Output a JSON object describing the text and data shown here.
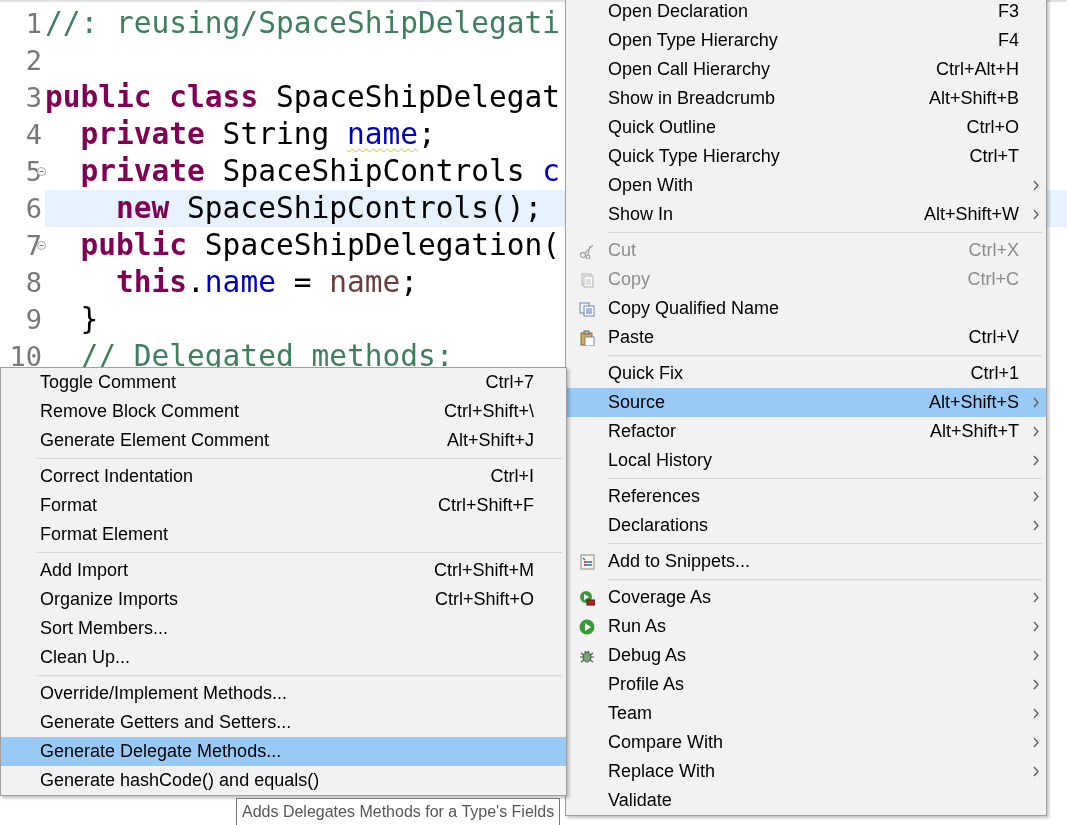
{
  "editor": {
    "lines": [
      {
        "number": "1",
        "fold": false,
        "current": false,
        "tokens": [
          {
            "kind": "comment",
            "text": "//: reusing/SpaceShipDelegati"
          }
        ]
      },
      {
        "number": "2",
        "fold": false,
        "current": false
      },
      {
        "number": "3",
        "fold": false,
        "current": false,
        "tokens": [
          {
            "kind": "keyword",
            "text": "public"
          },
          {
            "kind": "keyword",
            "text": " class"
          },
          {
            "kind": "plain",
            "text": " SpaceShipDelegat"
          }
        ]
      },
      {
        "number": "4",
        "fold": false,
        "current": false,
        "tokens": [
          {
            "kind": "keyword",
            "text": "  private"
          },
          {
            "kind": "plain",
            "text": " String "
          },
          {
            "kind": "field",
            "text": "name",
            "warning": true
          },
          {
            "kind": "plain",
            "text": ";"
          }
        ]
      },
      {
        "number": "5",
        "fold": true,
        "current": false,
        "tokens": [
          {
            "kind": "keyword",
            "text": "  private"
          },
          {
            "kind": "plain",
            "text": " SpaceShipControls "
          },
          {
            "kind": "field",
            "text": "c",
            "warning": false
          }
        ]
      },
      {
        "number": "6",
        "fold": false,
        "current": true,
        "tokens": [
          {
            "kind": "keyword",
            "text": "    new"
          },
          {
            "kind": "plain",
            "text": " SpaceShipControls();"
          }
        ]
      },
      {
        "number": "7",
        "fold": true,
        "current": false,
        "tokens": [
          {
            "kind": "keyword",
            "text": "  public"
          },
          {
            "kind": "plain",
            "text": " SpaceShipDelegation("
          }
        ]
      },
      {
        "number": "8",
        "fold": false,
        "current": false,
        "tokens": [
          {
            "kind": "keyword",
            "text": "    this"
          },
          {
            "kind": "plain",
            "text": "."
          },
          {
            "kind": "field",
            "text": "name",
            "warning": false
          },
          {
            "kind": "plain",
            "text": " = "
          },
          {
            "kind": "param",
            "text": "name"
          },
          {
            "kind": "plain",
            "text": ";"
          }
        ]
      },
      {
        "number": "9",
        "fold": false,
        "current": false,
        "tokens": [
          {
            "kind": "plain",
            "text": "  }"
          }
        ]
      },
      {
        "number": "10",
        "fold": false,
        "current": false,
        "tokens": [
          {
            "kind": "comment",
            "text": "  // Delegated methods:"
          }
        ]
      }
    ]
  },
  "context_menu": {
    "sections": [
      {
        "items": [
          {
            "label": "Open Declaration",
            "shortcut": "F3",
            "submenu": false,
            "disabled": false,
            "selected": false
          },
          {
            "label": "Open Type Hierarchy",
            "shortcut": "F4",
            "submenu": false,
            "disabled": false,
            "selected": false
          },
          {
            "label": "Open Call Hierarchy",
            "shortcut": "Ctrl+Alt+H",
            "submenu": false,
            "disabled": false,
            "selected": false
          },
          {
            "label": "Show in Breadcrumb",
            "shortcut": "Alt+Shift+B",
            "submenu": false,
            "disabled": false,
            "selected": false
          },
          {
            "label": "Quick Outline",
            "shortcut": "Ctrl+O",
            "submenu": false,
            "disabled": false,
            "selected": false
          },
          {
            "label": "Quick Type Hierarchy",
            "shortcut": "Ctrl+T",
            "submenu": false,
            "disabled": false,
            "selected": false
          },
          {
            "label": "Open With",
            "submenu": true,
            "disabled": false,
            "selected": false
          },
          {
            "label": "Show In",
            "shortcut": "Alt+Shift+W",
            "submenu": true,
            "disabled": false,
            "selected": false
          }
        ]
      },
      {
        "items": [
          {
            "label": "Cut",
            "shortcut": "Ctrl+X",
            "submenu": false,
            "disabled": true,
            "selected": false
          },
          {
            "label": "Copy",
            "shortcut": "Ctrl+C",
            "submenu": false,
            "disabled": true,
            "selected": false
          },
          {
            "label": "Copy Qualified Name",
            "submenu": false,
            "disabled": false,
            "selected": false
          },
          {
            "label": "Paste",
            "shortcut": "Ctrl+V",
            "submenu": false,
            "disabled": false,
            "selected": false
          }
        ]
      },
      {
        "items": [
          {
            "label": "Quick Fix",
            "shortcut": "Ctrl+1",
            "submenu": false,
            "disabled": false,
            "selected": false
          },
          {
            "label": "Source",
            "shortcut": "Alt+Shift+S",
            "submenu": true,
            "disabled": false,
            "selected": true
          },
          {
            "label": "Refactor",
            "shortcut": "Alt+Shift+T",
            "submenu": true,
            "disabled": false,
            "selected": false
          },
          {
            "label": "Local History",
            "submenu": true,
            "disabled": false,
            "selected": false
          }
        ]
      },
      {
        "items": [
          {
            "label": "References",
            "submenu": true,
            "disabled": false,
            "selected": false
          },
          {
            "label": "Declarations",
            "submenu": true,
            "disabled": false,
            "selected": false
          }
        ]
      },
      {
        "items": [
          {
            "label": "Add to Snippets...",
            "submenu": false,
            "disabled": false,
            "selected": false
          }
        ]
      },
      {
        "items": [
          {
            "label": "Coverage As",
            "submenu": true,
            "disabled": false,
            "selected": false
          },
          {
            "label": "Run As",
            "submenu": true,
            "disabled": false,
            "selected": false
          },
          {
            "label": "Debug As",
            "submenu": true,
            "disabled": false,
            "selected": false
          },
          {
            "label": "Profile As",
            "submenu": true,
            "disabled": false,
            "selected": false
          },
          {
            "label": "Team",
            "submenu": true,
            "disabled": false,
            "selected": false
          },
          {
            "label": "Compare With",
            "submenu": true,
            "disabled": false,
            "selected": false
          },
          {
            "label": "Replace With",
            "submenu": true,
            "disabled": false,
            "selected": false
          },
          {
            "label": "Validate",
            "submenu": false,
            "disabled": false,
            "selected": false
          }
        ]
      }
    ]
  },
  "source_submenu": {
    "sections": [
      {
        "items": [
          {
            "label": "Toggle Comment",
            "shortcut": "Ctrl+7",
            "selected": false
          },
          {
            "label": "Remove Block Comment",
            "shortcut": "Ctrl+Shift+\\",
            "selected": false
          },
          {
            "label": "Generate Element Comment",
            "shortcut": "Alt+Shift+J",
            "selected": false
          }
        ]
      },
      {
        "items": [
          {
            "label": "Correct Indentation",
            "shortcut": "Ctrl+I",
            "selected": false
          },
          {
            "label": "Format",
            "shortcut": "Ctrl+Shift+F",
            "selected": false
          },
          {
            "label": "Format Element",
            "selected": false
          }
        ]
      },
      {
        "items": [
          {
            "label": "Add Import",
            "shortcut": "Ctrl+Shift+M",
            "selected": false
          },
          {
            "label": "Organize Imports",
            "shortcut": "Ctrl+Shift+O",
            "selected": false
          },
          {
            "label": "Sort Members...",
            "selected": false
          },
          {
            "label": "Clean Up...",
            "selected": false
          }
        ]
      },
      {
        "items": [
          {
            "label": "Override/Implement Methods...",
            "selected": false
          },
          {
            "label": "Generate Getters and Setters...",
            "selected": false
          },
          {
            "label": "Generate Delegate Methods...",
            "selected": true
          },
          {
            "label": "Generate hashCode() and equals()",
            "selected": false
          }
        ]
      }
    ]
  },
  "tooltip": {
    "text": "Adds Delegates Methods for a Type's Fields"
  }
}
